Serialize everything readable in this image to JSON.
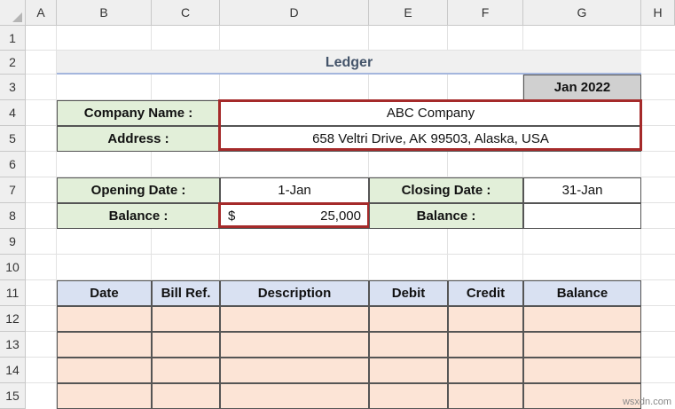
{
  "columns": [
    "A",
    "B",
    "C",
    "D",
    "E",
    "F",
    "G",
    "H"
  ],
  "rows": [
    "1",
    "2",
    "3",
    "4",
    "5",
    "6",
    "7",
    "8",
    "9",
    "10",
    "11",
    "12",
    "13",
    "14",
    "15"
  ],
  "ledger": {
    "title": "Ledger",
    "month": "Jan 2022",
    "company_label": "Company Name :",
    "company_value": "ABC Company",
    "address_label": "Address :",
    "address_value": "658 Veltri Drive, AK 99503, Alaska, USA",
    "opening_date_label": "Opening Date :",
    "opening_date_value": "1-Jan",
    "closing_date_label": "Closing Date :",
    "closing_date_value": "31-Jan",
    "balance_label": "Balance :",
    "balance_currency": "$",
    "balance_value": "25,000",
    "closing_balance_label": "Balance :",
    "closing_balance_value": ""
  },
  "table": {
    "headers": [
      "Date",
      "Bill Ref.",
      "Description",
      "Debit",
      "Credit",
      "Balance"
    ]
  },
  "watermark": "wsxdn.com",
  "colors": {
    "label_bg": "#e2efd9",
    "header_bg": "#d9e1f2",
    "body_bg": "#fce4d6",
    "highlight_border": "#a52a2a"
  }
}
